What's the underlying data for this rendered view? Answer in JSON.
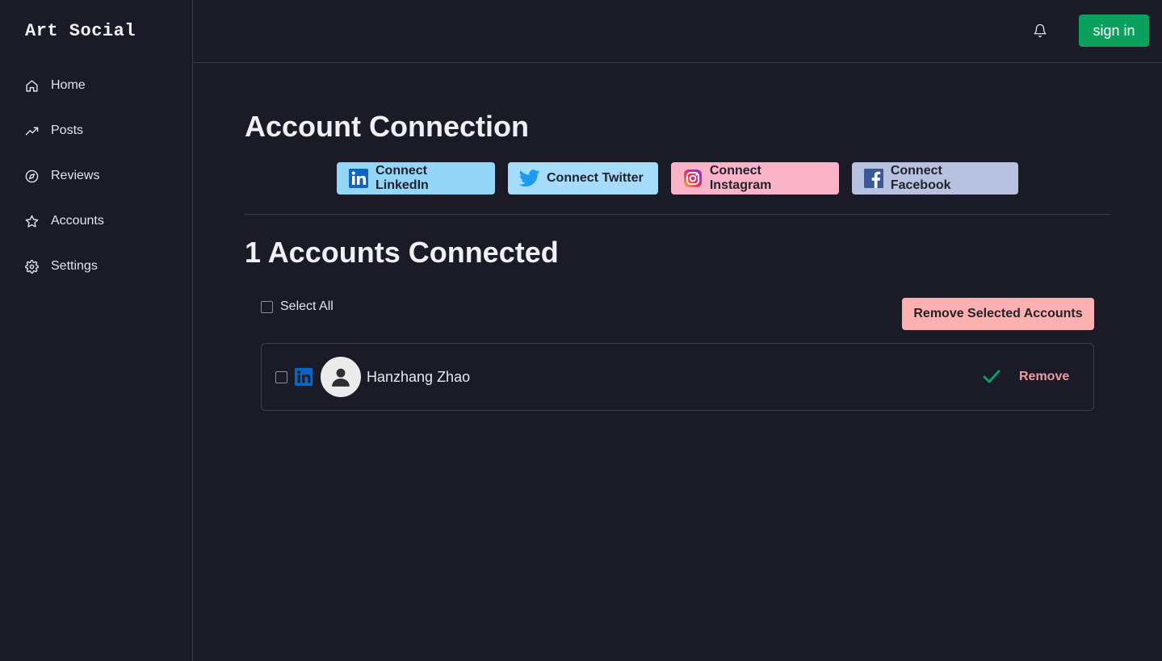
{
  "app": {
    "title": "Art Social"
  },
  "sidebar": {
    "items": [
      {
        "label": "Home",
        "icon": "home-icon"
      },
      {
        "label": "Posts",
        "icon": "trending-up-icon"
      },
      {
        "label": "Reviews",
        "icon": "compass-icon"
      },
      {
        "label": "Accounts",
        "icon": "star-icon"
      },
      {
        "label": "Settings",
        "icon": "gear-icon"
      }
    ]
  },
  "header": {
    "notification_icon": "bell-icon",
    "signin_label": "sign in",
    "signin_color": "#0aa05e"
  },
  "main": {
    "title": "Account Connection",
    "connect_buttons": [
      {
        "label": "Connect LinkedIn",
        "icon": "linkedin-icon",
        "color": "#93d6f7"
      },
      {
        "label": "Connect Twitter",
        "icon": "twitter-icon",
        "color": "#a4dcfa"
      },
      {
        "label": "Connect Instagram",
        "icon": "instagram-icon",
        "color": "#fbb4c7"
      },
      {
        "label": "Connect Facebook",
        "icon": "facebook-icon",
        "color": "#b6c2e0"
      }
    ],
    "connected_title": "1 Accounts Connected",
    "select_all_label": "Select All",
    "remove_selected_label": "Remove Selected Accounts",
    "accounts": [
      {
        "name": "Hanzhang Zhao",
        "platform_icon": "linkedin-icon",
        "status_icon": "check-icon",
        "remove_label": "Remove"
      }
    ]
  }
}
